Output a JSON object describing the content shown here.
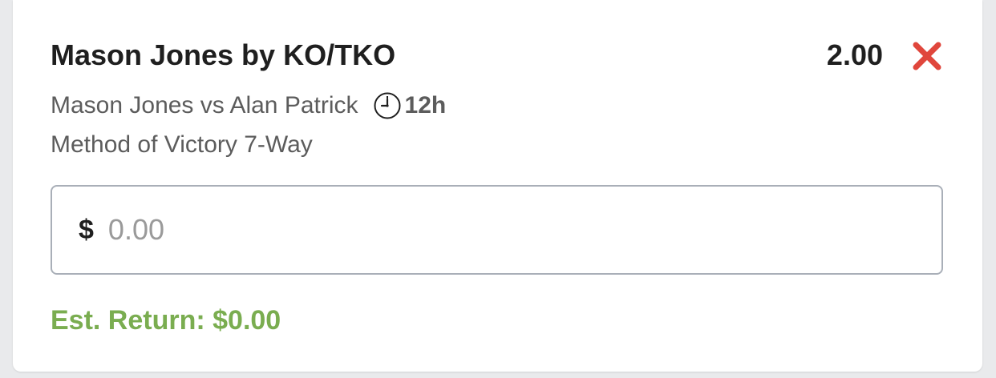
{
  "bet": {
    "selection": "Mason Jones by KO/TKO",
    "odds": "2.00",
    "event": "Mason Jones vs Alan Patrick",
    "time_to_start": "12h",
    "market": "Method of Victory 7-Way"
  },
  "stake": {
    "currency_symbol": "$",
    "placeholder": "0.00",
    "value": ""
  },
  "est_return": "Est. Return: $0.00",
  "icons": {
    "remove": "close-icon",
    "clock": "clock-icon"
  },
  "colors": {
    "remove": "#e0463c",
    "est_return": "#7aad50"
  }
}
